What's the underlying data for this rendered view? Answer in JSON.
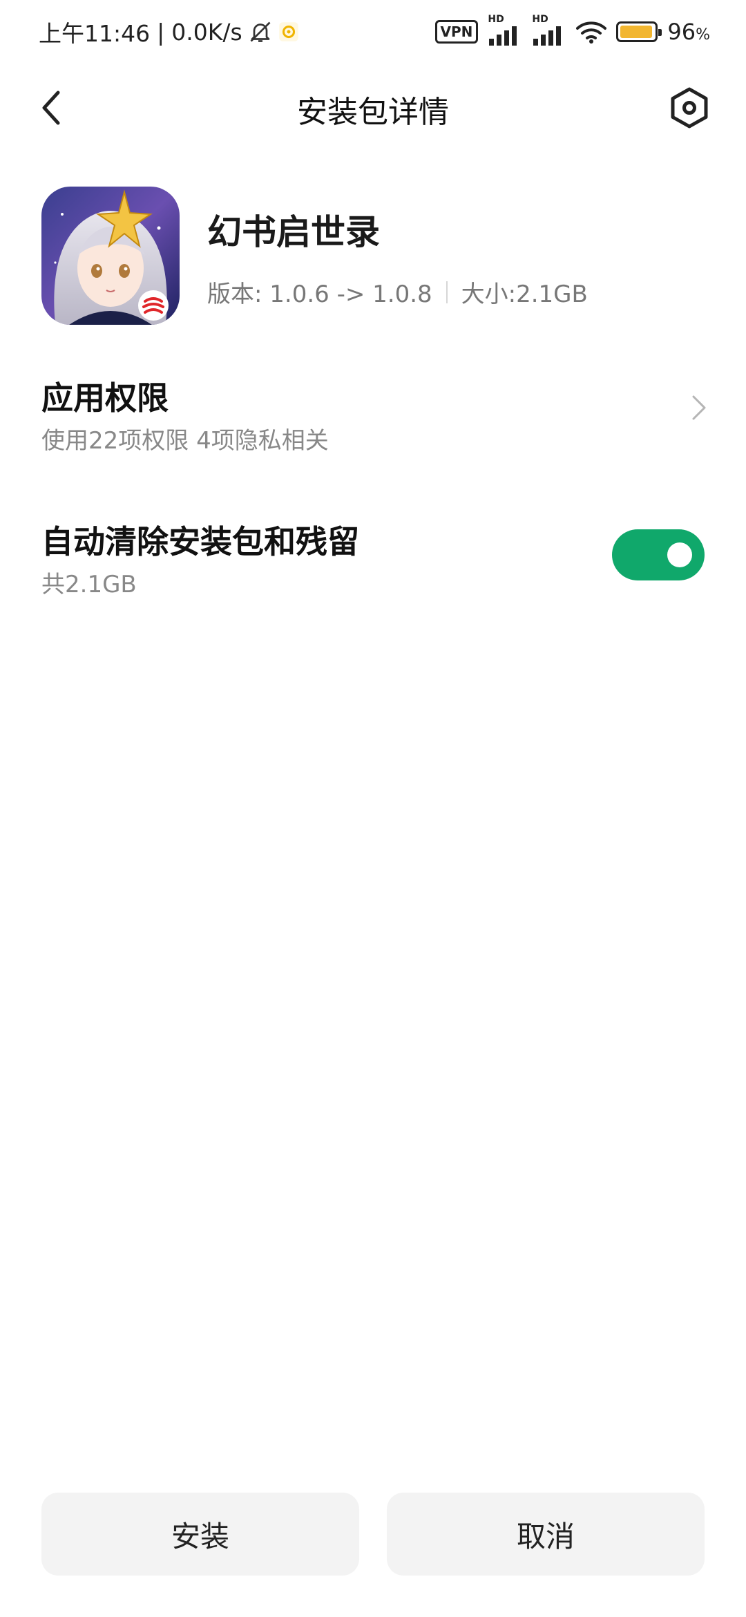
{
  "status_bar": {
    "time": "上午11:46",
    "separator": "|",
    "net_speed": "0.0K/s",
    "vpn": "VPN",
    "hd1": "HD",
    "hd2": "HD",
    "battery": "96",
    "battery_unit": "%",
    "battery_level": 0.96,
    "battery_color": "#f2b630"
  },
  "header": {
    "title": "安装包详情",
    "back_icon": "chevron-left-icon",
    "settings_icon": "hexagon-settings-icon"
  },
  "app": {
    "name": "幻书启世录",
    "version": "版本: 1.0.6 -> 1.0.8",
    "size": "大小:2.1GB"
  },
  "permissions": {
    "title": "应用权限",
    "subtitle": "使用22项权限 4项隐私相关"
  },
  "auto_clean": {
    "title": "自动清除安装包和残留",
    "subtitle": "共2.1GB",
    "enabled": true,
    "toggle_color": "#10a86b"
  },
  "actions": {
    "install": "安装",
    "cancel": "取消"
  }
}
